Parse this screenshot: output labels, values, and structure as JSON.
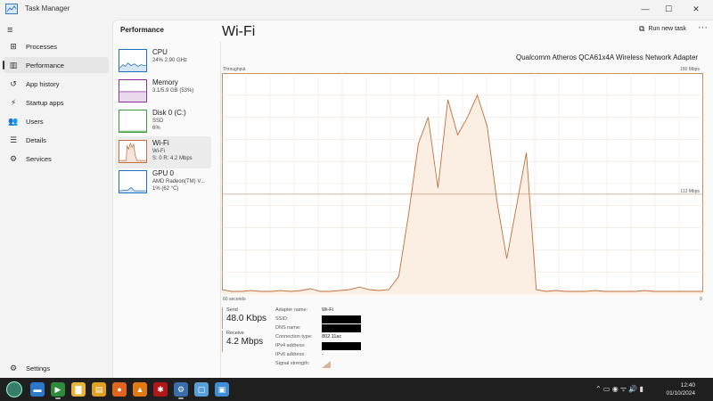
{
  "window": {
    "title": "Task Manager",
    "minimize": "—",
    "maximize": "☐",
    "close": "✕"
  },
  "nav": {
    "menu_icon": "≡",
    "items": [
      {
        "icon": "grid-icon",
        "glyph": "⊞",
        "label": "Processes"
      },
      {
        "icon": "performance-icon",
        "glyph": "▥",
        "label": "Performance",
        "active": true
      },
      {
        "icon": "history-icon",
        "glyph": "↺",
        "label": "App history"
      },
      {
        "icon": "startup-icon",
        "glyph": "⚡",
        "label": "Startup apps"
      },
      {
        "icon": "users-icon",
        "glyph": "👥",
        "label": "Users"
      },
      {
        "icon": "details-icon",
        "glyph": "☰",
        "label": "Details"
      },
      {
        "icon": "services-icon",
        "glyph": "⚙",
        "label": "Services"
      }
    ],
    "settings": {
      "icon": "gear-icon",
      "glyph": "⚙",
      "label": "Settings"
    }
  },
  "main": {
    "title": "Performance",
    "run_new_task": "Run new task",
    "more": "···"
  },
  "devices": [
    {
      "name": "CPU",
      "sub1": "24% 2.90 GHz",
      "sub2": "",
      "color": "#1f6fbf"
    },
    {
      "name": "Memory",
      "sub1": "3.1/5.9 GB (53%)",
      "sub2": "",
      "color": "#8a2f9c"
    },
    {
      "name": "Disk 0 (C:)",
      "sub1": "SSD",
      "sub2": "6%",
      "color": "#3a9a3a"
    },
    {
      "name": "Wi-Fi",
      "sub1": "Wi-Fi",
      "sub2": "S: 0 R: 4.2 Mbps",
      "color": "#c0703a",
      "active": true
    },
    {
      "name": "GPU 0",
      "sub1": "AMD Radeon(TM) V...",
      "sub2": "1% (62 °C)",
      "color": "#1f6fbf"
    }
  ],
  "detail": {
    "title": "Wi-Fi",
    "adapter": "Qualcomm Atheros QCA61x4A Wireless Network Adapter",
    "throughput_label": "Throughput",
    "max_label": "150 Mbps",
    "mid_label": "113 Mbps",
    "seconds_label": "60 seconds",
    "zero_label": "0",
    "send_label": "Send",
    "send_value": "48.0 Kbps",
    "receive_label": "Receive",
    "receive_value": "4.2 Mbps",
    "accent": "#c0703a",
    "fill": "#fbeee2",
    "properties": [
      {
        "key": "Adapter name:",
        "value": "Wi-Fi"
      },
      {
        "key": "SSID:",
        "value": "",
        "redacted": true
      },
      {
        "key": "DNS name:",
        "value": "",
        "redacted": true
      },
      {
        "key": "Connection type:",
        "value": "802.11ac"
      },
      {
        "key": "IPv4 address:",
        "value": "",
        "redacted": true
      },
      {
        "key": "IPv6 address:",
        "value": "-"
      },
      {
        "key": "Signal strength:",
        "value": "",
        "signal": true
      }
    ]
  },
  "throughput_series": [
    5,
    3,
    3,
    4,
    3,
    3,
    4,
    3,
    4,
    6,
    3,
    3,
    4,
    5,
    8,
    5,
    4,
    5,
    20,
    90,
    170,
    200,
    120,
    220,
    180,
    200,
    225,
    190,
    105,
    40,
    100,
    160,
    5,
    3,
    4,
    3,
    3,
    3,
    4,
    3,
    3,
    3,
    3,
    4,
    3,
    3,
    3,
    3,
    3,
    3
  ],
  "throughput_max_mbps": 250,
  "taskbar": {
    "apps": [
      {
        "name": "terminal-icon",
        "glyph": "▬",
        "color": "#2b77c9"
      },
      {
        "name": "green-app-icon",
        "glyph": "▶",
        "color": "#2e8b3a"
      },
      {
        "name": "file-explorer-icon",
        "glyph": "▇",
        "color": "#e8b43a"
      },
      {
        "name": "files-icon",
        "glyph": "▤",
        "color": "#e0a020"
      },
      {
        "name": "firefox-icon",
        "glyph": "●",
        "color": "#e0641e"
      },
      {
        "name": "vlc-icon",
        "glyph": "▲",
        "color": "#e07a10"
      },
      {
        "name": "red-app-icon",
        "glyph": "✱",
        "color": "#b01818"
      },
      {
        "name": "settings-app-icon",
        "glyph": "⚙",
        "color": "#3a6ea8"
      },
      {
        "name": "screen-app-icon",
        "glyph": "▢",
        "color": "#5aa0d8"
      },
      {
        "name": "photos-icon",
        "glyph": "▣",
        "color": "#3f8fd8"
      }
    ],
    "tray_glyphs": "⌃  ▭  ◉  ᯤ  🔊  ▮",
    "time": "12:40",
    "date": "01/10/2024"
  }
}
